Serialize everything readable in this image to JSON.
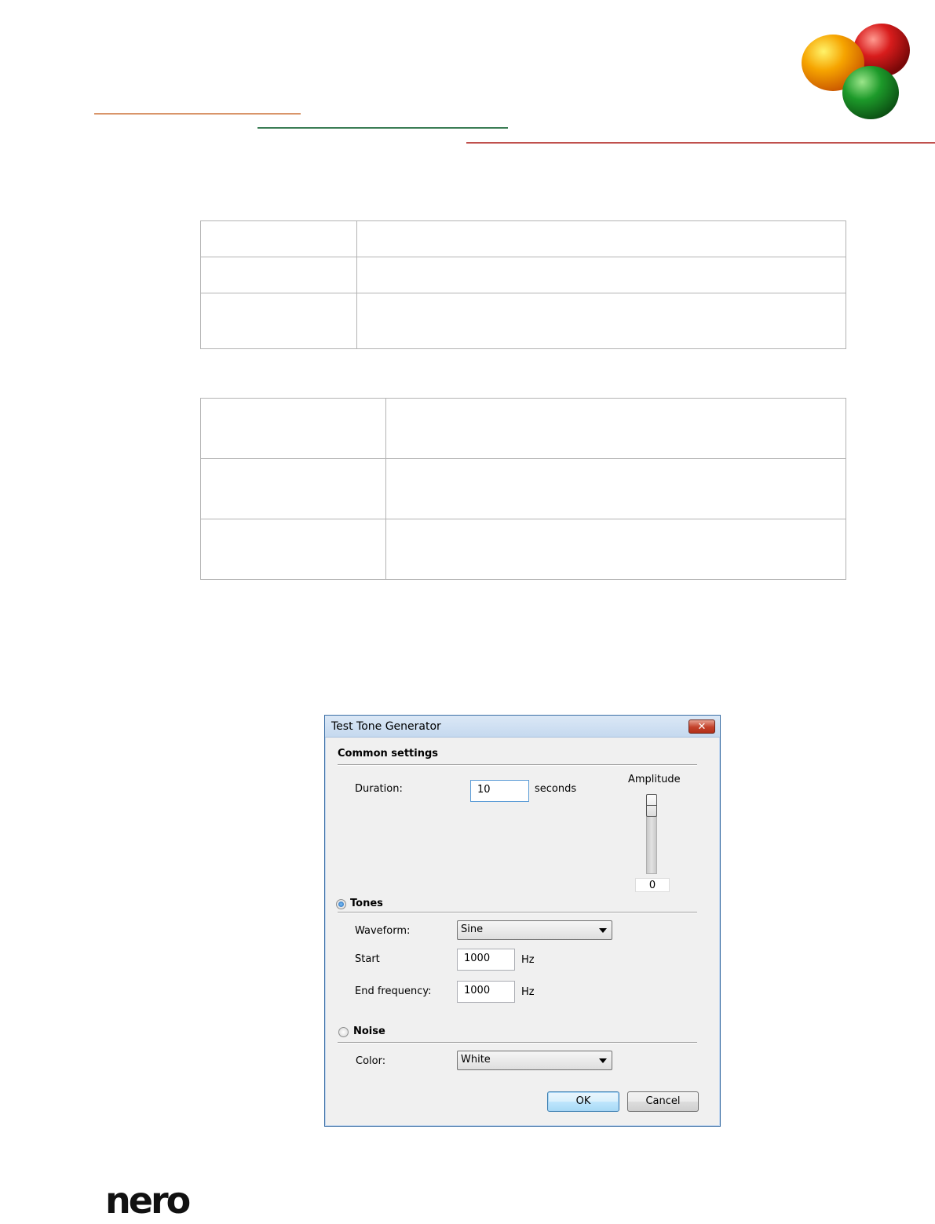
{
  "colors": {
    "line_orange": "#d9956a",
    "line_green": "#3b7d55",
    "line_red": "#c0504d",
    "accent_blue": "#3a6ea5"
  },
  "logo": {
    "text": "nero"
  },
  "dialog": {
    "title": "Test Tone Generator",
    "close_icon": "✕",
    "common": {
      "heading": "Common settings",
      "duration_label": "Duration:",
      "duration_value": "10",
      "duration_unit": "seconds",
      "amplitude_label": "Amplitude",
      "amplitude_value": "0",
      "amplitude_level": 1.0
    },
    "tones": {
      "heading": "Tones",
      "selected": true,
      "waveform_label": "Waveform:",
      "waveform_value": "Sine",
      "start_label": "Start",
      "start_value": "1000",
      "start_unit": "Hz",
      "end_label": "End frequency:",
      "end_value": "1000",
      "end_unit": "Hz"
    },
    "noise": {
      "heading": "Noise",
      "selected": false,
      "color_label": "Color:",
      "color_value": "White"
    },
    "ok_label": "OK",
    "cancel_label": "Cancel"
  }
}
